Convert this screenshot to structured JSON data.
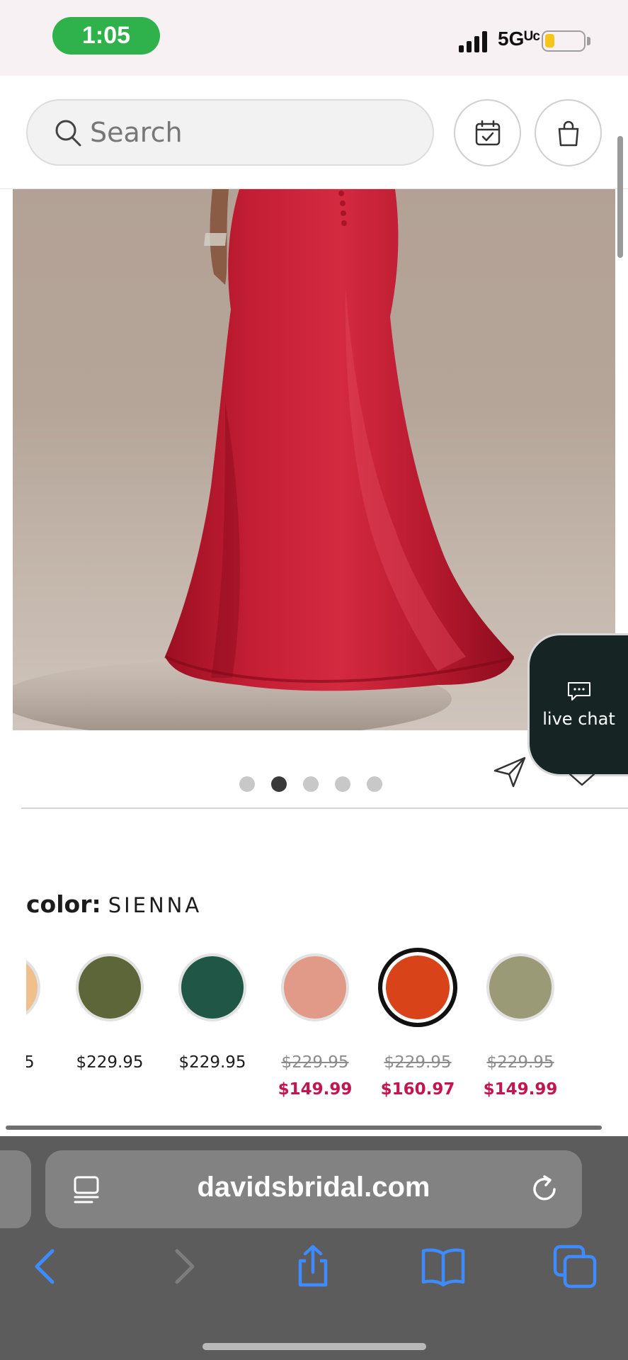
{
  "status_bar": {
    "time": "1:05",
    "network": "5Gᵁᶜ",
    "battery_level": 0.25
  },
  "header": {
    "search_placeholder": "Search",
    "icons": [
      "search-icon",
      "calendar-check-icon",
      "shopping-bag-icon"
    ]
  },
  "gallery": {
    "total_images": 5,
    "active_index": 2,
    "image_description_icon": "red-satin-gown-photo"
  },
  "live_chat": {
    "label": "live chat",
    "icon": "chat-bubble-icon"
  },
  "color_selector": {
    "label": "color:",
    "selected": "SIENNA",
    "swatches": [
      {
        "color": "#efc08c",
        "price": "5",
        "price_prefix_hidden": true
      },
      {
        "color": "#5c6639",
        "price": "$229.95"
      },
      {
        "color": "#1f5645",
        "price": "$229.95"
      },
      {
        "color": "#e29a88",
        "price_original": "$229.95",
        "price_sale": "$149.99"
      },
      {
        "color": "#d8431a",
        "price_original": "$229.95",
        "price_sale": "$160.97",
        "selected": true
      },
      {
        "color": "#9b9a76",
        "price_original": "$229.95",
        "price_sale": "$149.99"
      }
    ]
  },
  "browser": {
    "url": "davidsbridal.com",
    "toolbar": [
      "back-icon",
      "forward-icon",
      "share-icon",
      "bookmarks-icon",
      "tabs-icon"
    ]
  },
  "colors": {
    "accent_sale": "#c3154f",
    "status_green": "#2fb24c",
    "chat_bg": "#172424"
  }
}
